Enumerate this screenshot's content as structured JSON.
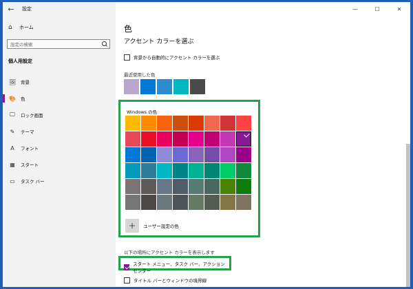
{
  "titlebar": {
    "back_icon": "back-arrow-icon",
    "title": "設定",
    "minimize": "—",
    "maximize": "☐",
    "close": "✕"
  },
  "sidebar": {
    "home_label": "ホーム",
    "search_placeholder": "設定の検索",
    "section_title": "個人用設定",
    "items": [
      {
        "icon": "🖼",
        "icon_name": "background-icon",
        "label": "背景",
        "active": false
      },
      {
        "icon": "🎨",
        "icon_name": "palette-icon",
        "label": "色",
        "active": true
      },
      {
        "icon": "🖵",
        "icon_name": "lockscreen-icon",
        "label": "ロック画面",
        "active": false
      },
      {
        "icon": "✎",
        "icon_name": "theme-icon",
        "label": "テーマ",
        "active": false
      },
      {
        "icon": "A",
        "icon_name": "font-icon",
        "label": "フォント",
        "active": false
      },
      {
        "icon": "▦",
        "icon_name": "start-icon",
        "label": "スタート",
        "active": false
      },
      {
        "icon": "▭",
        "icon_name": "taskbar-icon",
        "label": "タスク バー",
        "active": false
      }
    ]
  },
  "main": {
    "page_title": "色",
    "accent_title": "アクセント カラーを選ぶ",
    "auto_accent_label": "背景から自動的にアクセント カラーを選ぶ",
    "recent_label": "最近使用した色",
    "recent_colors": [
      "#b9a6cd",
      "#0078d7",
      "#2d8bd0",
      "#00b7c3",
      "#4c4a48"
    ],
    "windows_colors_label": "Windows の色",
    "windows_colors": [
      "#ffb900",
      "#ff8c00",
      "#f7630c",
      "#ca5010",
      "#da3b01",
      "#ef6950",
      "#d13438",
      "#ff4343",
      "#e74856",
      "#e81123",
      "#ea005e",
      "#c30052",
      "#e3008c",
      "#bf0077",
      "#c239b3",
      "#881798",
      "#0078d7",
      "#0063b1",
      "#8e8cd8",
      "#6b69d6",
      "#8764b8",
      "#744da9",
      "#b146c2",
      "#9a0089",
      "#0099bc",
      "#2d7d9a",
      "#00b7c3",
      "#038387",
      "#00b294",
      "#018574",
      "#00cc6a",
      "#10893e",
      "#7a7574",
      "#5d5a58",
      "#68768a",
      "#515c6b",
      "#567c73",
      "#486860",
      "#498205",
      "#107c10",
      "#767676",
      "#4c4a48",
      "#69797e",
      "#4a5459",
      "#647c64",
      "#525e54",
      "#847545",
      "#7e735f"
    ],
    "selected_index": 15,
    "custom_color_label": "ユーザー設定の色",
    "show_accent_label": "以下の場所にアクセント カラーを表示します",
    "start_taskbar_label": "スタート メニュー、タスク バー、アクション センター",
    "titlebar_borders_label": "タイトル バーとウィンドウの境界線"
  },
  "colors": {
    "accent": "#881798",
    "highlight_box": "#24a34d"
  }
}
